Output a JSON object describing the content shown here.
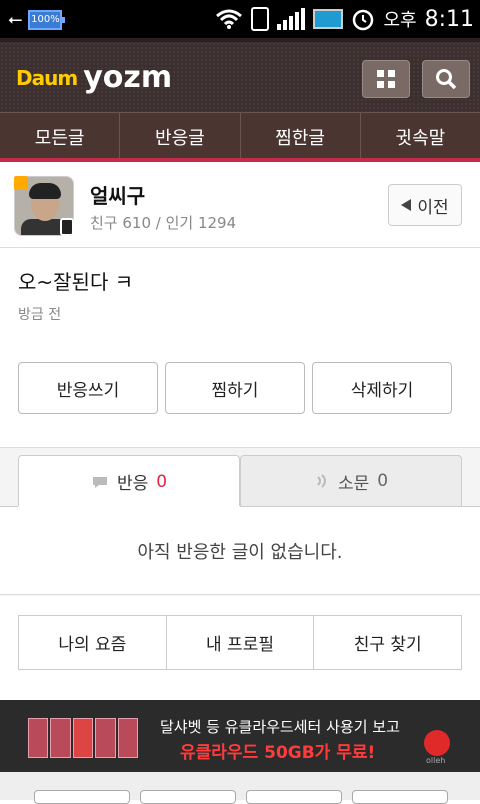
{
  "status": {
    "battery": "100%",
    "ampm": "오후",
    "time": "8:11"
  },
  "logo": {
    "daum": "Daum",
    "yozm": "yozm"
  },
  "menu": [
    "모든글",
    "반응글",
    "찜한글",
    "귓속말"
  ],
  "profile": {
    "name": "얼씨구",
    "stats": "친구 610  /  인기 1294",
    "prev_label": "이전"
  },
  "post": {
    "text": "오~잘된다 ㅋ",
    "time": "방금 전"
  },
  "actions": [
    "반응쓰기",
    "찜하기",
    "삭제하기"
  ],
  "tabs": [
    {
      "label": "반응",
      "count": "0"
    },
    {
      "label": "소문",
      "count": "0"
    }
  ],
  "empty_msg": "아직 반응한 글이 없습니다.",
  "bottom_nav": [
    "나의 요즘",
    "내 프로필",
    "친구 찾기"
  ],
  "ad": {
    "line1": "달샤벳 등 유클라우드세터 사용기 보고",
    "line2": "유클라우드 50GB가 무료!",
    "logo": "olleh"
  },
  "icons": {
    "usb": "usb-icon",
    "wifi": "wifi-icon",
    "vibrate": "vibrate-icon",
    "signal": "signal-icon",
    "alarm": "alarm-icon",
    "grid": "grid-icon",
    "search": "search-icon",
    "back": "back-arrow-icon",
    "reply": "reply-icon",
    "rumor": "rumor-icon"
  }
}
